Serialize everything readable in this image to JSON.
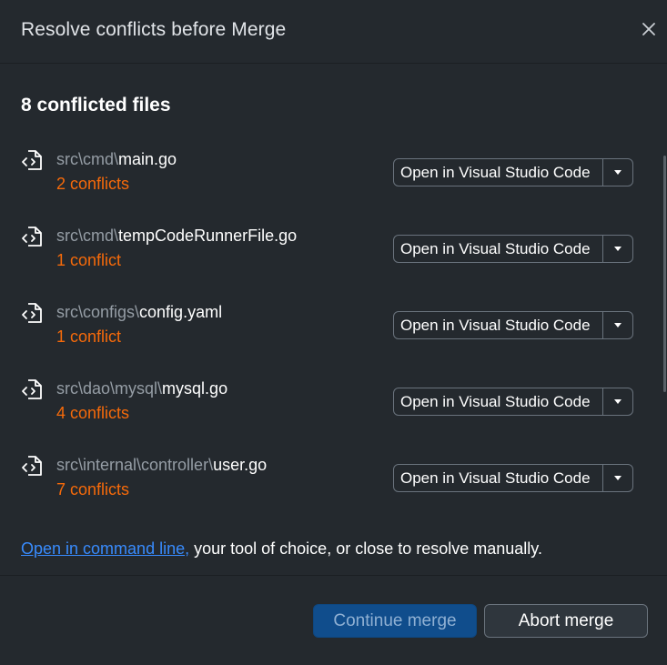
{
  "dialog": {
    "title": "Resolve conflicts before Merge"
  },
  "heading": "8 conflicted files",
  "files": [
    {
      "dir": "src\\cmd\\",
      "name": "main.go",
      "conflicts": "2 conflicts",
      "open_label": "Open in Visual Studio Code"
    },
    {
      "dir": "src\\cmd\\",
      "name": "tempCodeRunnerFile.go",
      "conflicts": "1 conflict",
      "open_label": "Open in Visual Studio Code"
    },
    {
      "dir": "src\\configs\\",
      "name": "config.yaml",
      "conflicts": "1 conflict",
      "open_label": "Open in Visual Studio Code"
    },
    {
      "dir": "src\\dao\\mysql\\",
      "name": "mysql.go",
      "conflicts": "4 conflicts",
      "open_label": "Open in Visual Studio Code"
    },
    {
      "dir": "src\\internal\\controller\\",
      "name": "user.go",
      "conflicts": "7 conflicts",
      "open_label": "Open in Visual Studio Code"
    }
  ],
  "manual": {
    "link_text": "Open in command line,",
    "rest_text": " your tool of choice, or close to resolve manually."
  },
  "footer": {
    "continue_label": "Continue merge",
    "abort_label": "Abort merge"
  },
  "icons": {
    "close": "close-icon",
    "file_code": "file-code-icon",
    "caret": "triangle-down-icon"
  },
  "colors": {
    "background": "#24292e",
    "conflict": "#f66a0a",
    "link": "#388bfd",
    "primary_button": "#104d8c"
  }
}
